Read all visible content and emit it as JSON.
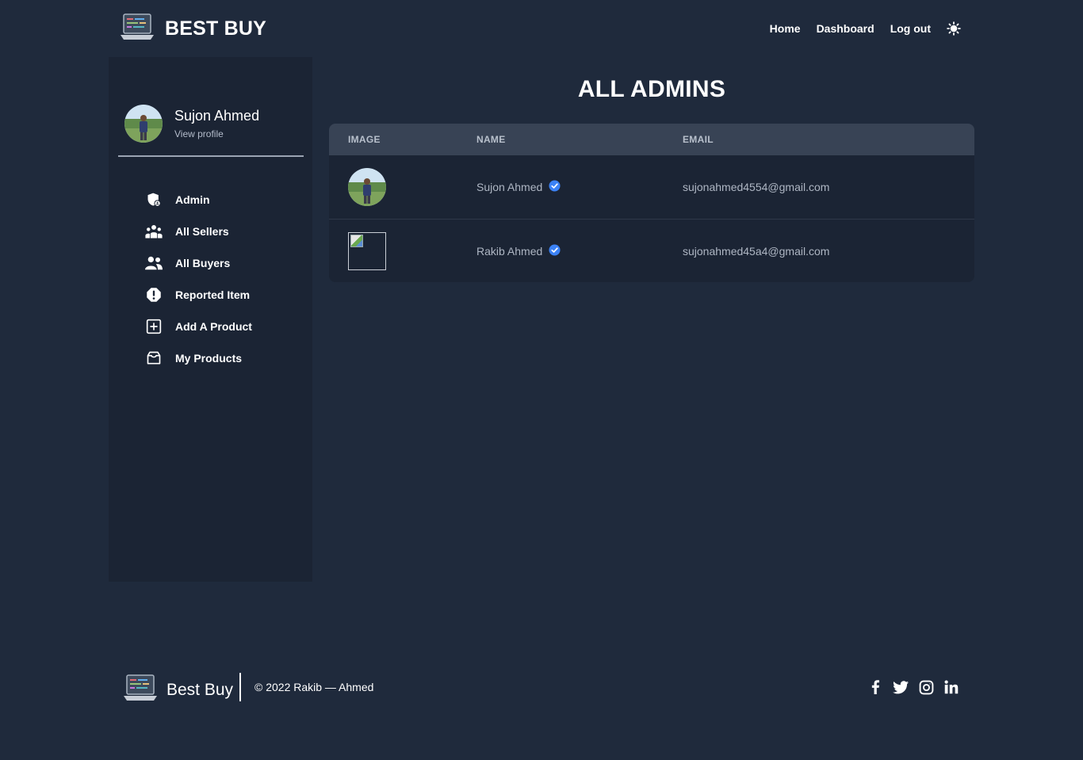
{
  "header": {
    "brand": "BEST BUY",
    "logo_icon": "laptop-icon",
    "nav": [
      {
        "label": "Home"
      },
      {
        "label": "Dashboard"
      },
      {
        "label": "Log out"
      }
    ],
    "theme_icon": "sun-icon"
  },
  "sidebar": {
    "profile": {
      "name": "Sujon Ahmed",
      "link": "View profile"
    },
    "items": [
      {
        "label": "Admin",
        "icon": "shield-user-icon"
      },
      {
        "label": "All Sellers",
        "icon": "users-group-icon"
      },
      {
        "label": "All Buyers",
        "icon": "users-icon"
      },
      {
        "label": "Reported Item",
        "icon": "alert-icon"
      },
      {
        "label": "Add A Product",
        "icon": "plus-square-icon"
      },
      {
        "label": "My Products",
        "icon": "inbox-icon"
      }
    ]
  },
  "main": {
    "title": "ALL ADMINS",
    "table": {
      "headers": [
        "IMAGE",
        "NAME",
        "EMAIL"
      ],
      "rows": [
        {
          "name": "Sujon Ahmed",
          "email": "sujonahmed4554@gmail.com",
          "verified": true,
          "image": "avatar-photo"
        },
        {
          "name": "Rakib Ahmed",
          "email": "sujonahmed45a4@gmail.com",
          "verified": true,
          "image": "broken-image"
        }
      ]
    }
  },
  "footer": {
    "brand": "Best Buy",
    "copyright": "© 2022 Rakib — Ahmed",
    "socials": [
      "facebook-icon",
      "twitter-icon",
      "instagram-icon",
      "linkedin-icon"
    ]
  },
  "colors": {
    "background": "#1f2a3c",
    "sidebar": "#1b2434",
    "table_header": "#384355",
    "verified": "#3b82f6"
  }
}
